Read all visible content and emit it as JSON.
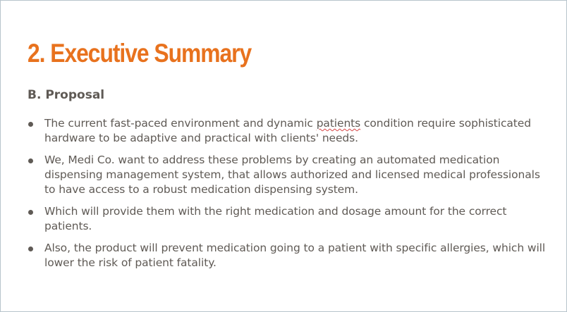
{
  "slide": {
    "title": "2. Executive Summary",
    "subtitle": "B. Proposal",
    "bullets": [
      {
        "before": "The current fast-paced environment and dynamic ",
        "flagged": "patients",
        "after": " condition require sophisticated hardware to be adaptive and practical with clients' needs."
      },
      {
        "text": "We, Medi Co. want to address these problems by creating an automated medication dispensing management system, that allows authorized and licensed medical professionals to have access to a robust medication dispensing system."
      },
      {
        "text": "Which will provide them with the right medication and dosage amount for the correct patients."
      },
      {
        "text": "Also, the product will prevent medication going to a patient with specific allergies, which will lower the risk of patient fatality."
      }
    ],
    "colors": {
      "title": "#e8721e",
      "body": "#5f5a55",
      "spellcheck": "#d64545"
    }
  }
}
